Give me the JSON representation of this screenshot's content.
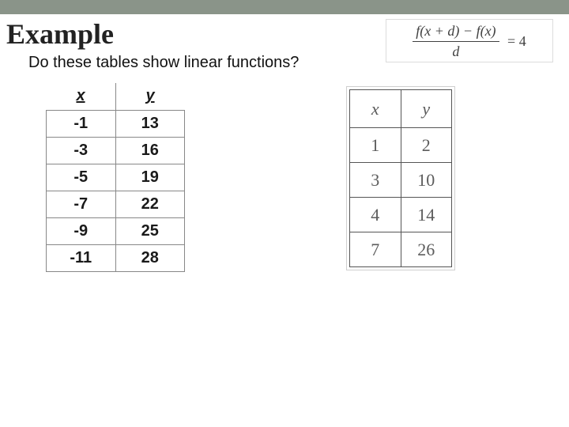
{
  "heading": "Example",
  "subtitle": "Do these tables show linear functions?",
  "equation": {
    "numerator": "f(x + d) − f(x)",
    "denominator": "d",
    "rhs": "= 4"
  },
  "chart_data": [
    {
      "type": "table",
      "headers": [
        "x",
        "y"
      ],
      "rows": [
        {
          "x": "-1",
          "y": "13"
        },
        {
          "x": "-3",
          "y": "16"
        },
        {
          "x": "-5",
          "y": "19"
        },
        {
          "x": "-7",
          "y": "22"
        },
        {
          "x": "-9",
          "y": "25"
        },
        {
          "x": "-11",
          "y": "28"
        }
      ]
    },
    {
      "type": "table",
      "headers": [
        "x",
        "y"
      ],
      "rows": [
        {
          "x": "1",
          "y": "2"
        },
        {
          "x": "3",
          "y": "10"
        },
        {
          "x": "4",
          "y": "14"
        },
        {
          "x": "7",
          "y": "26"
        }
      ]
    }
  ]
}
